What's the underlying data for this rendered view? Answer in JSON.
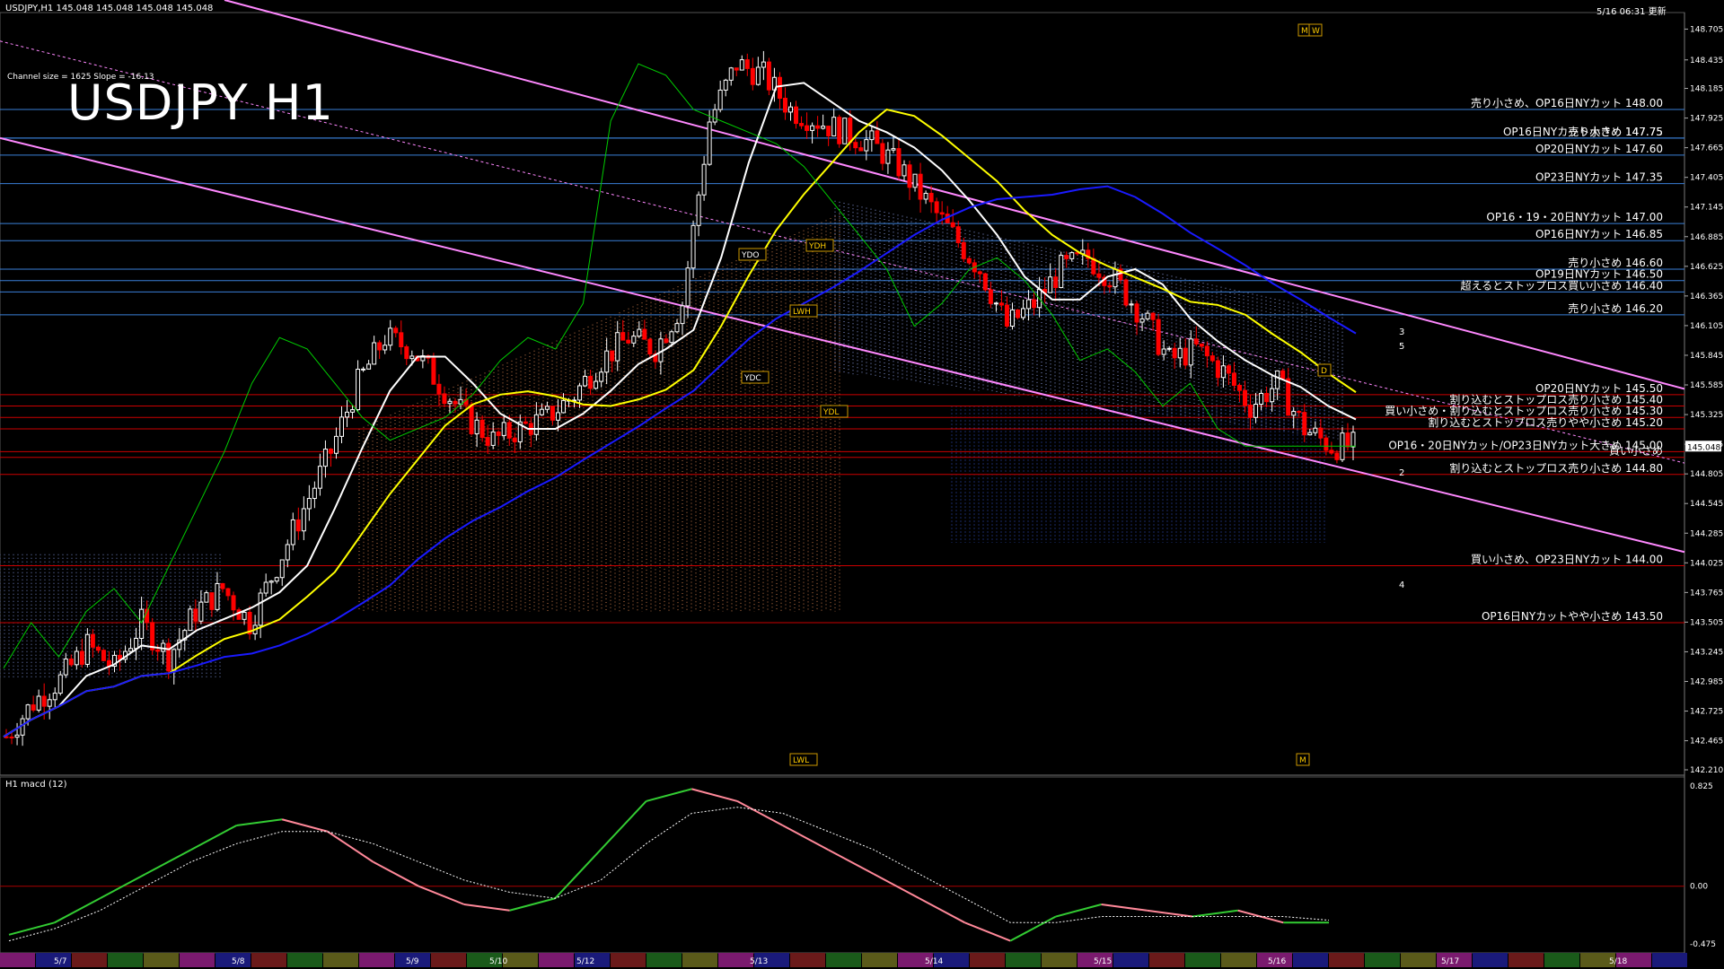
{
  "header": {
    "symbol_info": "USDJPY,H1  145.048 145.048 145.048 145.048",
    "timestamp": "5/16 06:31 更新",
    "channel_info": "Channel size = 1625 Slope = -16.13",
    "title": "USDJPY H1"
  },
  "colors": {
    "background": "#000000",
    "bull_candle": "#ffffff",
    "bear_candle": "#ff0000",
    "support_line": "#cc0000",
    "resistance_line": "#3a7fd8",
    "ma_fast": "#ffffff",
    "ma_mid": "#ffff00",
    "ma_slow": "#1a1aff",
    "channel": "#ff88ff",
    "chikou": "#00cc00",
    "macd": "#33cc33",
    "macd_down": "#ff8899"
  },
  "chart_data": [
    {
      "type": "candlestick",
      "title": "USDJPY H1",
      "ylim": [
        142.21,
        148.85
      ],
      "price_axis_ticks": [
        "148.705",
        "148.435",
        "148.185",
        "147.925",
        "147.665",
        "147.405",
        "147.145",
        "146.885",
        "146.625",
        "146.365",
        "146.105",
        "145.845",
        "145.585",
        "145.325",
        "145.065",
        "144.805",
        "144.545",
        "144.285",
        "144.025",
        "143.765",
        "143.505",
        "143.245",
        "142.985",
        "142.725",
        "142.465",
        "142.210"
      ],
      "current_price": "145.048",
      "date_labels": [
        "5/7",
        "5/8",
        "5/9",
        "5/10",
        "5/12",
        "5/13",
        "5/14",
        "5/15",
        "5/16",
        "5/17",
        "5/18"
      ],
      "close_path": [
        142.5,
        142.8,
        143.0,
        143.3,
        143.1,
        143.5,
        143.2,
        143.6,
        143.8,
        143.5,
        144.0,
        144.5,
        145.0,
        145.6,
        146.0,
        145.9,
        145.6,
        145.3,
        145.1,
        145.2,
        145.3,
        145.5,
        145.8,
        146.0,
        145.9,
        146.3,
        147.9,
        148.4,
        148.3,
        148.0,
        147.9,
        147.8,
        147.7,
        147.5,
        147.2,
        146.9,
        146.6,
        146.1,
        146.3,
        146.6,
        146.7,
        146.5,
        146.2,
        145.8,
        145.9,
        145.7,
        145.4,
        145.6,
        145.2,
        145.048
      ],
      "horizontal_levels": [
        {
          "price": 148.0,
          "color": "blue",
          "label": "売り小さめ、OP16日NYカット 148.00"
        },
        {
          "price": 147.75,
          "color": "blue",
          "label": "OP16日NYカット大きめ 147.75"
        },
        {
          "price": 147.75,
          "color": "blue",
          "label": "売り小さめ 147.75"
        },
        {
          "price": 147.6,
          "color": "blue",
          "label": "OP20日NYカット 147.60"
        },
        {
          "price": 147.35,
          "color": "blue",
          "label": "OP23日NYカット 147.35"
        },
        {
          "price": 147.0,
          "color": "blue",
          "label": "OP16・19・20日NYカット 147.00"
        },
        {
          "price": 146.85,
          "color": "blue",
          "label": "OP16日NYカット 146.85"
        },
        {
          "price": 146.6,
          "color": "blue",
          "label": "売り小さめ 146.60"
        },
        {
          "price": 146.5,
          "color": "blue",
          "label": "OP19日NYカット 146.50"
        },
        {
          "price": 146.4,
          "color": "blue",
          "label": "超えるとストップロス買い小さめ 146.40"
        },
        {
          "price": 146.2,
          "color": "blue",
          "label": "売り小さめ 146.20"
        },
        {
          "price": 145.5,
          "color": "red",
          "label": "OP20日NYカット 145.50"
        },
        {
          "price": 145.4,
          "color": "red",
          "label": "割り込むとストップロス売り小さめ 145.40"
        },
        {
          "price": 145.3,
          "color": "red",
          "label": "買い小さめ・割り込むとストップロス売り小さめ 145.30"
        },
        {
          "price": 145.2,
          "color": "red",
          "label": "割り込むとストップロス売りやや小さめ 145.20"
        },
        {
          "price": 145.0,
          "color": "red",
          "label": "OP16・20日NYカット/OP23日NYカット大きめ 145.00"
        },
        {
          "price": 144.95,
          "color": "red",
          "label": "買い小さめ"
        },
        {
          "price": 144.8,
          "color": "red",
          "label": "割り込むとストップロス売り小さめ 144.80"
        },
        {
          "price": 144.0,
          "color": "red",
          "label": "買い小さめ、OP23日NYカット 144.00"
        },
        {
          "price": 143.5,
          "color": "red",
          "label": "OP16日NYカットやや小さめ 143.50"
        }
      ],
      "annotations": [
        "YDO",
        "YDH",
        "LWH",
        "YDC",
        "YDL",
        "LWL",
        "D",
        "M",
        "W",
        "M"
      ],
      "wave_labels": [
        "3",
        "5",
        "2",
        "4"
      ]
    },
    {
      "type": "line",
      "title": "H1 macd (12)",
      "ylim": [
        -0.475,
        0.825
      ],
      "axis_ticks": [
        "0.825",
        "0.00",
        "-0.475"
      ],
      "series": [
        {
          "name": "macd",
          "values": [
            -0.4,
            -0.3,
            -0.1,
            0.1,
            0.3,
            0.5,
            0.55,
            0.45,
            0.2,
            0.0,
            -0.15,
            -0.2,
            -0.1,
            0.3,
            0.7,
            0.8,
            0.7,
            0.5,
            0.3,
            0.1,
            -0.1,
            -0.3,
            -0.45,
            -0.25,
            -0.15,
            -0.2,
            -0.25,
            -0.2,
            -0.3,
            -0.3
          ]
        },
        {
          "name": "signal",
          "values": [
            -0.45,
            -0.35,
            -0.2,
            0.0,
            0.2,
            0.35,
            0.45,
            0.45,
            0.35,
            0.2,
            0.05,
            -0.05,
            -0.1,
            0.05,
            0.35,
            0.6,
            0.65,
            0.6,
            0.45,
            0.3,
            0.1,
            -0.1,
            -0.3,
            -0.3,
            -0.25,
            -0.25,
            -0.25,
            -0.25,
            -0.25,
            -0.28
          ]
        }
      ],
      "zero_line_price": 0.0
    }
  ]
}
